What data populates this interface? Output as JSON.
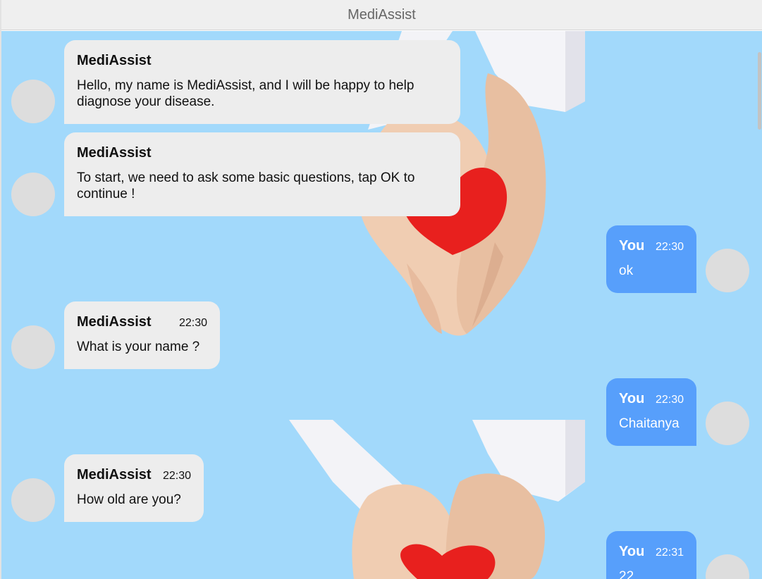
{
  "header": {
    "title": "MediAssist"
  },
  "messages": [
    {
      "sender": "MediAssist",
      "time": "",
      "text": "Hello, my name is MediAssist, and I will be happy to help diagnose your disease."
    },
    {
      "sender": "MediAssist",
      "time": "",
      "text": "To start, we need to ask some basic questions, tap OK to continue !"
    },
    {
      "sender": "You",
      "time": "22:30",
      "text": "ok"
    },
    {
      "sender": "MediAssist",
      "time": "22:30",
      "text": "What is your name ?"
    },
    {
      "sender": "You",
      "time": "22:30",
      "text": "Chaitanya"
    },
    {
      "sender": "MediAssist",
      "time": "22:30",
      "text": "How old are you?"
    },
    {
      "sender": "You",
      "time": "22:31",
      "text": "22"
    }
  ],
  "colors": {
    "chat_background": "#a2d9fb",
    "bot_bubble": "#ededed",
    "user_bubble": "#579ffb",
    "avatar": "#dddddd",
    "header": "#efefef"
  },
  "decor": {
    "background_image": "hands-holding-heart"
  }
}
